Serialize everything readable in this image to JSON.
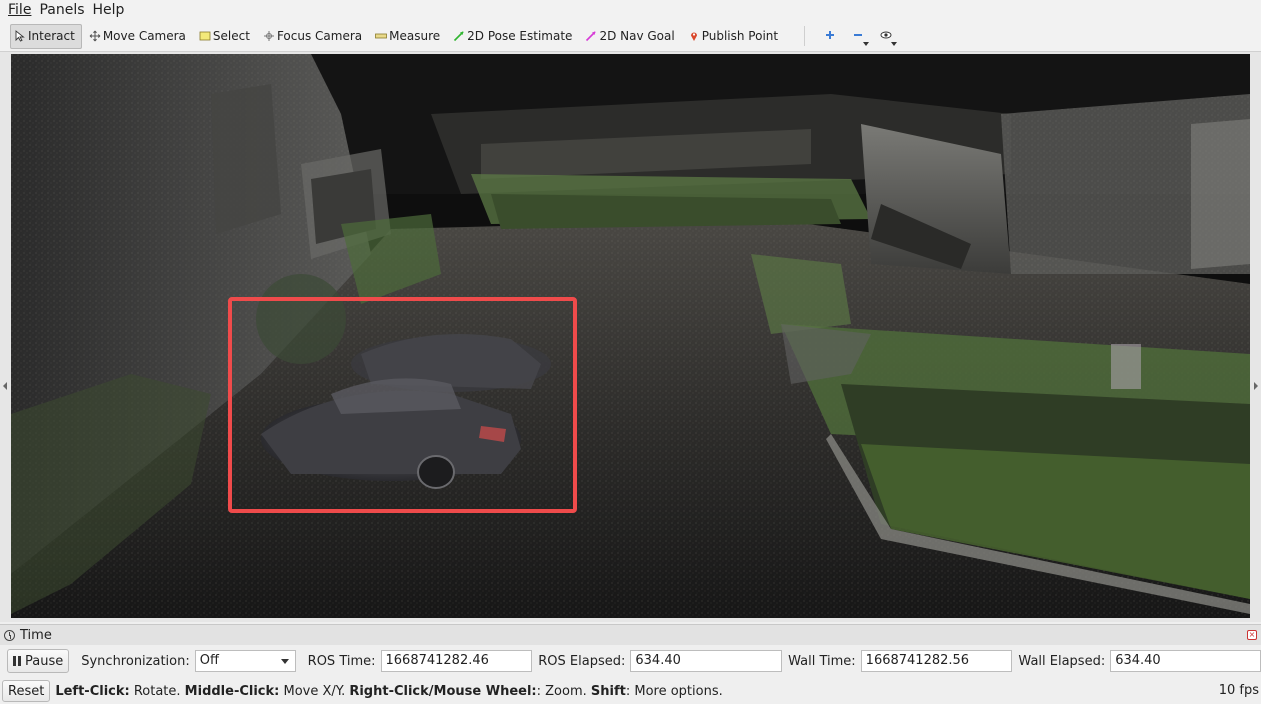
{
  "menu": [
    {
      "label": "File"
    },
    {
      "label": "Panels"
    },
    {
      "label": "Help"
    }
  ],
  "toolbar": {
    "tools": [
      {
        "label": "Interact",
        "icon": "cursor-icon"
      },
      {
        "label": "Move Camera",
        "icon": "move-arrows-icon"
      },
      {
        "label": "Select",
        "icon": "select-rectangle-icon"
      },
      {
        "label": "Focus Camera",
        "icon": "focus-target-icon"
      },
      {
        "label": "Measure",
        "icon": "ruler-icon"
      },
      {
        "label": "2D Pose Estimate",
        "icon": "green-arrow-icon"
      },
      {
        "label": "2D Nav Goal",
        "icon": "pink-arrow-icon"
      },
      {
        "label": "Publish Point",
        "icon": "map-pin-icon"
      }
    ],
    "extra": [
      "add-tool-icon",
      "remove-tool-icon",
      "eye-view-icon"
    ]
  },
  "time_panel": {
    "title": "Time",
    "pause_label": "Pause",
    "sync_label": "Synchronization:",
    "sync_value": "Off",
    "ros_time_label": "ROS Time:",
    "ros_time_value": "1668741282.46",
    "ros_elapsed_label": "ROS Elapsed:",
    "ros_elapsed_value": "634.40",
    "wall_time_label": "Wall Time:",
    "wall_time_value": "1668741282.56",
    "wall_elapsed_label": "Wall Elapsed:",
    "wall_elapsed_value": "634.40"
  },
  "status": {
    "reset_label": "Reset",
    "k1": "Left-Click:",
    "v1": " Rotate. ",
    "k2": "Middle-Click:",
    "v2": " Move X/Y. ",
    "k3": "Right-Click/Mouse Wheel:",
    "v3": ": Zoom. ",
    "k4": "Shift",
    "v4": ": More options.",
    "fps": "10 fps"
  },
  "colors": {
    "highlight": "#ef4b4b",
    "pose_arrow": "#2fb52f",
    "nav_arrow": "#d63ad6",
    "pin": "#d9472b",
    "select_fill": "#f3e97a"
  }
}
